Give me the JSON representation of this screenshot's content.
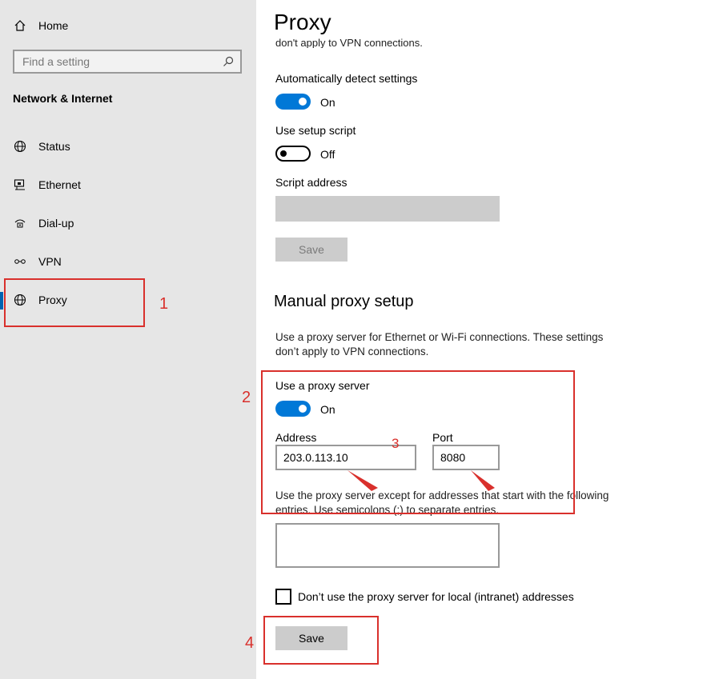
{
  "sidebar": {
    "home_label": "Home",
    "search_placeholder": "Find a setting",
    "section_title": "Network & Internet",
    "items": [
      {
        "label": "Status",
        "icon": "globe-icon"
      },
      {
        "label": "Ethernet",
        "icon": "ethernet-icon"
      },
      {
        "label": "Dial-up",
        "icon": "dialup-icon"
      },
      {
        "label": "VPN",
        "icon": "vpn-icon"
      },
      {
        "label": "Proxy",
        "icon": "globe-icon",
        "active": true
      }
    ]
  },
  "main": {
    "title": "Proxy",
    "cut_text": "don't apply to VPN connections.",
    "auto_detect": {
      "label": "Automatically detect settings",
      "state": "On"
    },
    "setup_script": {
      "label": "Use setup script",
      "state": "Off"
    },
    "script_address": {
      "label": "Script address"
    },
    "script_save": "Save",
    "manual_heading": "Manual proxy setup",
    "manual_desc": "Use a proxy server for Ethernet or Wi-Fi connections. These settings don’t apply to VPN connections.",
    "use_proxy": {
      "label": "Use a proxy server",
      "state": "On"
    },
    "address": {
      "label": "Address",
      "value": "203.0.113.10"
    },
    "port": {
      "label": "Port",
      "value": "8080"
    },
    "exceptions_desc": "Use the proxy server except for addresses that start with the following entries. Use semicolons (;) to separate entries.",
    "local_checkbox_label": "Don’t use the proxy server for local (intranet) addresses",
    "save": "Save"
  },
  "annotations": [
    "1",
    "2",
    "3",
    "4"
  ],
  "colors": {
    "accent": "#0078d7",
    "annotation": "#d9302c",
    "sidebar_bg": "#e6e6e6"
  }
}
